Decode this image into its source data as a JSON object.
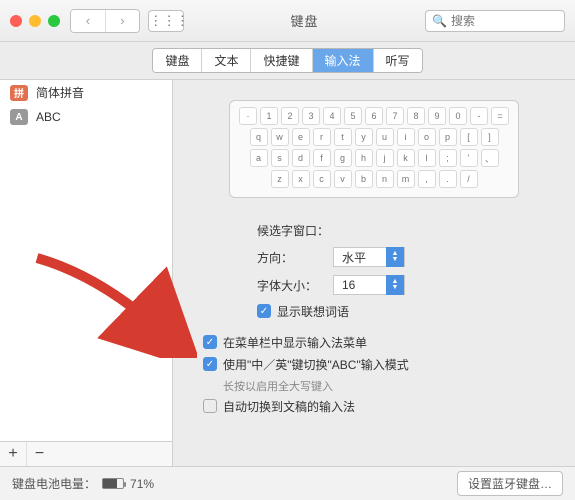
{
  "window": {
    "title": "键盘"
  },
  "toolbar": {
    "search_placeholder": "搜索"
  },
  "tabs": [
    {
      "label": "键盘",
      "active": false
    },
    {
      "label": "文本",
      "active": false
    },
    {
      "label": "快捷键",
      "active": false
    },
    {
      "label": "输入法",
      "active": true
    },
    {
      "label": "听写",
      "active": false
    }
  ],
  "sidebar": {
    "sources": [
      {
        "badge": "拼",
        "label": "简体拼音",
        "badge_kind": "py"
      },
      {
        "badge": "A",
        "label": "ABC",
        "badge_kind": "abc"
      }
    ],
    "add_label": "+",
    "remove_label": "−"
  },
  "keyboard_rows": [
    [
      "·",
      "1",
      "2",
      "3",
      "4",
      "5",
      "6",
      "7",
      "8",
      "9",
      "0",
      "-",
      "="
    ],
    [
      "q",
      "w",
      "e",
      "r",
      "t",
      "y",
      "u",
      "i",
      "o",
      "p",
      "[",
      "]"
    ],
    [
      "a",
      "s",
      "d",
      "f",
      "g",
      "h",
      "j",
      "k",
      "l",
      ";",
      "'",
      "、"
    ],
    [
      "z",
      "x",
      "c",
      "v",
      "b",
      "n",
      "m",
      ",",
      ".",
      "/"
    ]
  ],
  "settings": {
    "section_label": "候选字窗口：",
    "direction_label": "方向：",
    "direction_value": "水平",
    "fontsize_label": "字体大小：",
    "fontsize_value": "16",
    "show_assoc": {
      "checked": true,
      "label": "显示联想词语"
    },
    "show_menu": {
      "checked": true,
      "label": "在菜单栏中显示输入法菜单"
    },
    "cn_en_switch": {
      "checked": true,
      "label": "使用\"中／英\"键切换\"ABC\"输入模式"
    },
    "cn_en_hint": "长按以启用全大写键入",
    "auto_switch": {
      "checked": false,
      "label": "自动切换到文稿的输入法"
    }
  },
  "footer": {
    "battery_label": "键盘电池电量：",
    "battery_pct": "71%",
    "battery_fill_pct": 71,
    "bt_button": "设置蓝牙键盘…"
  }
}
